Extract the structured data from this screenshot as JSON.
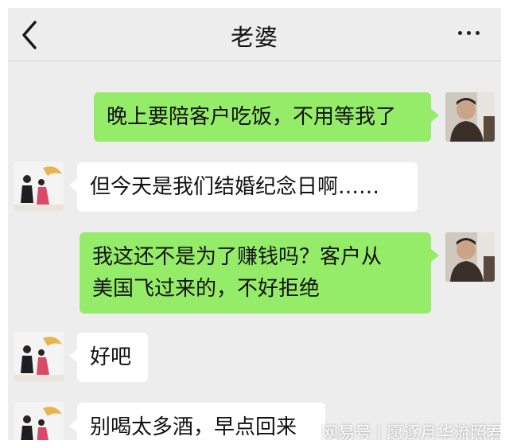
{
  "header": {
    "title": "老婆",
    "back_icon": "chevron-left-icon",
    "more_icon": "more-dots-icon"
  },
  "messages": [
    {
      "sender": "me",
      "text": "晚上要陪客户吃饭，不用等我了"
    },
    {
      "sender": "contact",
      "text": "但今天是我们结婚纪念日啊……"
    },
    {
      "sender": "me",
      "lines": [
        "我这还不是为了赚钱吗？客户从",
        "美国飞过来的，不好拒绝"
      ]
    },
    {
      "sender": "contact",
      "text": "好吧"
    },
    {
      "sender": "contact",
      "text": "别喝太多酒，早点回来"
    }
  ],
  "watermark": {
    "source": "网易号",
    "author": "愿逐月华流照君"
  },
  "colors": {
    "chat_background": "#ededed",
    "my_bubble": "#95ec69",
    "contact_bubble": "#ffffff"
  }
}
